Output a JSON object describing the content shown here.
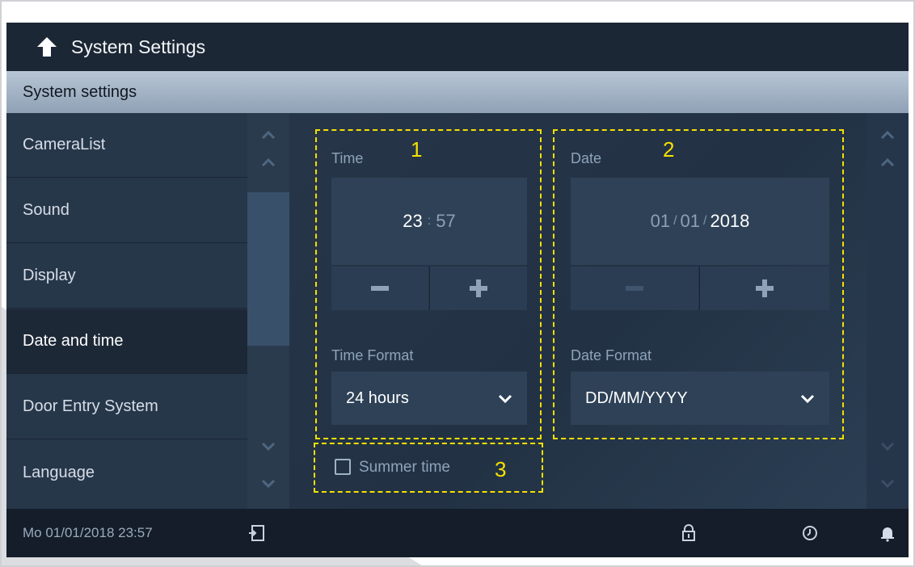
{
  "header": {
    "title": "System Settings"
  },
  "section": {
    "title": "System settings"
  },
  "sidebar": {
    "items": [
      {
        "label": "CameraList",
        "active": false
      },
      {
        "label": "Sound",
        "active": false
      },
      {
        "label": "Display",
        "active": false
      },
      {
        "label": "Date and time",
        "active": true
      },
      {
        "label": "Door Entry System",
        "active": false
      },
      {
        "label": "Language",
        "active": false
      }
    ]
  },
  "time": {
    "label": "Time",
    "hours": "23",
    "separator": ":",
    "minutes": "57",
    "minus": "−",
    "plus": "+",
    "format_label": "Time Format",
    "format_value": "24 hours"
  },
  "date": {
    "label": "Date",
    "day": "01",
    "month": "01",
    "year": "2018",
    "separator": "/",
    "minus": "−",
    "plus": "+",
    "format_label": "Date Format",
    "format_value": "DD/MM/YYYY"
  },
  "summer_time": {
    "label": "Summer time",
    "checked": false
  },
  "callouts": {
    "one": "1",
    "two": "2",
    "three": "3"
  },
  "status": {
    "datetime": "Mo 01/01/2018   23:57"
  },
  "colors": {
    "highlight": "#f6e000",
    "accent_bar": "#9fb0c4",
    "background": "#1f2a38"
  },
  "icons": [
    "back-arrow-icon",
    "logout-icon",
    "lock-icon",
    "history-icon",
    "bell-icon",
    "chevron-up-icon",
    "chevron-down-icon"
  ]
}
